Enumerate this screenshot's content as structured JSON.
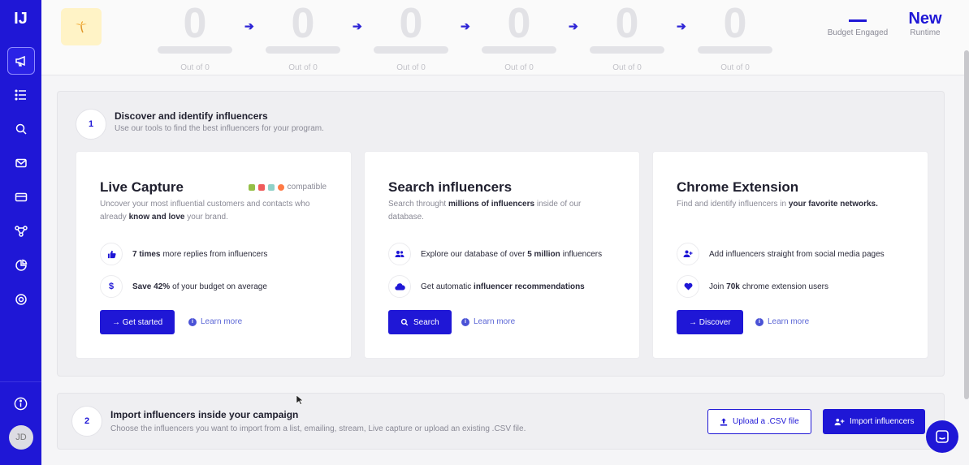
{
  "sidebar": {
    "logo": "IJ",
    "items": [
      {
        "icon": "megaphone-icon",
        "active": true
      },
      {
        "icon": "list-icon"
      },
      {
        "icon": "search-icon"
      },
      {
        "icon": "mail-icon"
      },
      {
        "icon": "card-icon"
      },
      {
        "icon": "workflow-icon"
      },
      {
        "icon": "analytics-icon"
      },
      {
        "icon": "support-icon"
      }
    ],
    "avatar": "JD"
  },
  "stats": {
    "stages": [
      {
        "value": "0",
        "label": "Out of 0"
      },
      {
        "value": "0",
        "label": "Out of 0"
      },
      {
        "value": "0",
        "label": "Out of 0"
      },
      {
        "value": "0",
        "label": "Out of 0"
      },
      {
        "value": "0",
        "label": "Out of 0"
      },
      {
        "value": "0",
        "label": "Out of 0"
      }
    ],
    "budget_label": "Budget Engaged",
    "runtime_value": "New",
    "runtime_label": "Runtime"
  },
  "step1": {
    "number": "1",
    "title": "Discover and identify influencers",
    "subtitle": "Use our tools to find the best influencers for your program.",
    "cards": [
      {
        "title": "Live Capture",
        "compat": "compatible",
        "desc_pre": "Uncover your most influential customers and contacts who already ",
        "desc_bold": "know and love",
        "desc_post": " your brand.",
        "feat1_bold": "7 times",
        "feat1_text": "more replies from influencers",
        "feat2_bold": "Save 42%",
        "feat2_text": "of your budget on average",
        "button": "→ Get started",
        "learn": "Learn more"
      },
      {
        "title": "Search influencers",
        "desc_pre": "Search throught ",
        "desc_bold": "millions of influencers",
        "desc_post": " inside of our database.",
        "feat1_text": "Explore our database of over",
        "feat1_bold": "5 million",
        "feat1_post": "influencers",
        "feat2_text": "Get automatic",
        "feat2_bold": "influencer recommendations",
        "button": "Search",
        "learn": "Learn more"
      },
      {
        "title": "Chrome Extension",
        "desc_pre": "Find and identify influencers in ",
        "desc_bold": "your favorite networks.",
        "feat1_text": "Add influencers straight from social media pages",
        "feat2_text": "Join",
        "feat2_bold": "70k",
        "feat2_post": "chrome extension users",
        "button": "→ Discover",
        "learn": "Learn more"
      }
    ]
  },
  "step2": {
    "number": "2",
    "title": "Import influencers inside your campaign",
    "subtitle": "Choose the influencers you want to import from a list, emailing, stream, Live capture or upload an existing .CSV file.",
    "upload_button": "Upload a .CSV file",
    "import_button": "Import influencers"
  }
}
